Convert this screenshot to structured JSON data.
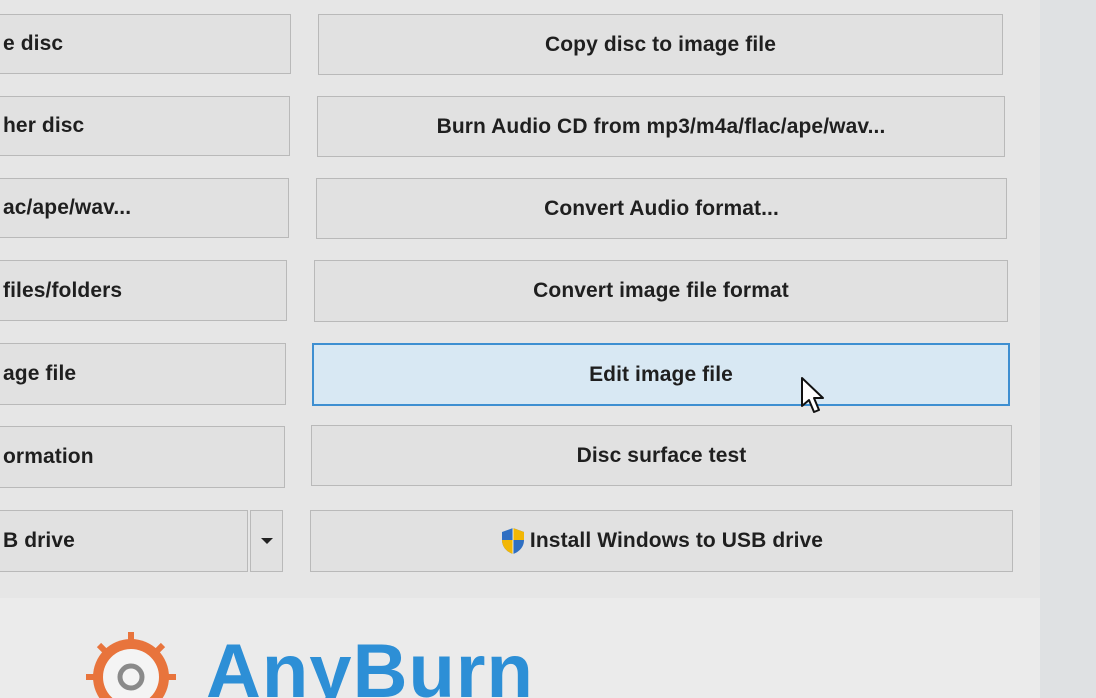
{
  "left_buttons": [
    {
      "label": "e disc"
    },
    {
      "label": "her disc"
    },
    {
      "label": "ac/ape/wav..."
    },
    {
      "label": "files/folders"
    },
    {
      "label": "age file"
    },
    {
      "label": "ormation"
    },
    {
      "label": "B drive"
    }
  ],
  "right_buttons": [
    {
      "label": "Copy disc to image file"
    },
    {
      "label": "Burn Audio CD from mp3/m4a/flac/ape/wav..."
    },
    {
      "label": "Convert Audio format..."
    },
    {
      "label": "Convert image file format"
    },
    {
      "label": "Edit image file",
      "state": "hover"
    },
    {
      "label": "Disc surface test"
    },
    {
      "label": "Install Windows to USB drive",
      "icon": "uac-shield-icon"
    }
  ],
  "brand": {
    "name": "AnyBurn",
    "color": "#2d8fd6",
    "icon": "burning-disc-logo-icon",
    "icon_color": "#e8743c"
  },
  "colors": {
    "hover_border": "#3e8fd1",
    "hover_fill": "#d8e8f3",
    "button_fill": "#e1e1e1"
  }
}
